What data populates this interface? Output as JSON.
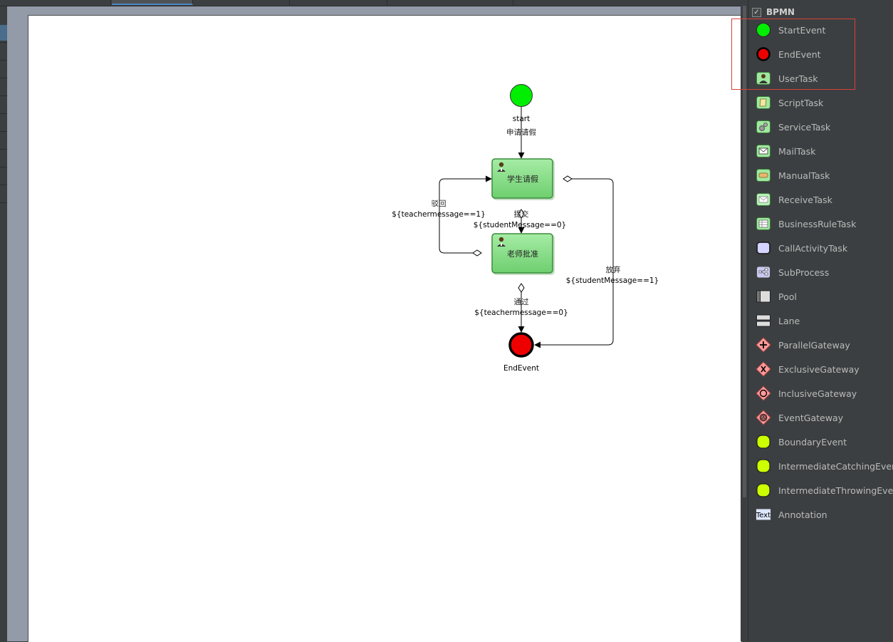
{
  "palette": {
    "title": "BPMN",
    "checked": true,
    "items": [
      {
        "label": "StartEvent",
        "icon": "start-event-icon"
      },
      {
        "label": "EndEvent",
        "icon": "end-event-icon"
      },
      {
        "label": "UserTask",
        "icon": "user-task-icon"
      },
      {
        "label": "ScriptTask",
        "icon": "script-task-icon"
      },
      {
        "label": "ServiceTask",
        "icon": "service-task-icon"
      },
      {
        "label": "MailTask",
        "icon": "mail-task-icon"
      },
      {
        "label": "ManualTask",
        "icon": "manual-task-icon"
      },
      {
        "label": "ReceiveTask",
        "icon": "receive-task-icon"
      },
      {
        "label": "BusinessRuleTask",
        "icon": "business-rule-task-icon"
      },
      {
        "label": "CallActivityTask",
        "icon": "call-activity-task-icon"
      },
      {
        "label": "SubProcess",
        "icon": "subprocess-icon"
      },
      {
        "label": "Pool",
        "icon": "pool-icon"
      },
      {
        "label": "Lane",
        "icon": "lane-icon"
      },
      {
        "label": "ParallelGateway",
        "icon": "parallel-gateway-icon"
      },
      {
        "label": "ExclusiveGateway",
        "icon": "exclusive-gateway-icon"
      },
      {
        "label": "InclusiveGateway",
        "icon": "inclusive-gateway-icon"
      },
      {
        "label": "EventGateway",
        "icon": "event-gateway-icon"
      },
      {
        "label": "BoundaryEvent",
        "icon": "boundary-event-icon"
      },
      {
        "label": "IntermediateCatchingEvent",
        "icon": "intermediate-catching-event-icon"
      },
      {
        "label": "IntermediateThrowingEvent",
        "icon": "intermediate-throwing-event-icon"
      },
      {
        "label": "Annotation",
        "icon": "annotation-icon",
        "icon_text": "Text"
      }
    ]
  },
  "diagram": {
    "start_label": "start",
    "end_label": "EndEvent",
    "task_student": "学生请假",
    "task_teacher": "老师批准",
    "flow_apply": "申请请假",
    "flow_submit": "提交",
    "flow_submit_cond": "${studentMessage==0}",
    "flow_reject": "驳回",
    "flow_reject_cond": "${teachermessage==1}",
    "flow_abandon": "放弃",
    "flow_abandon_cond": "${studentMessage==1}",
    "flow_pass": "通过",
    "flow_pass_cond": "${teachermessage==0}"
  },
  "colors": {
    "start_fill": "#00ee00",
    "end_fill": "#ee0000",
    "task_fill": "#8ee08e",
    "highlight": "#d9403a"
  }
}
